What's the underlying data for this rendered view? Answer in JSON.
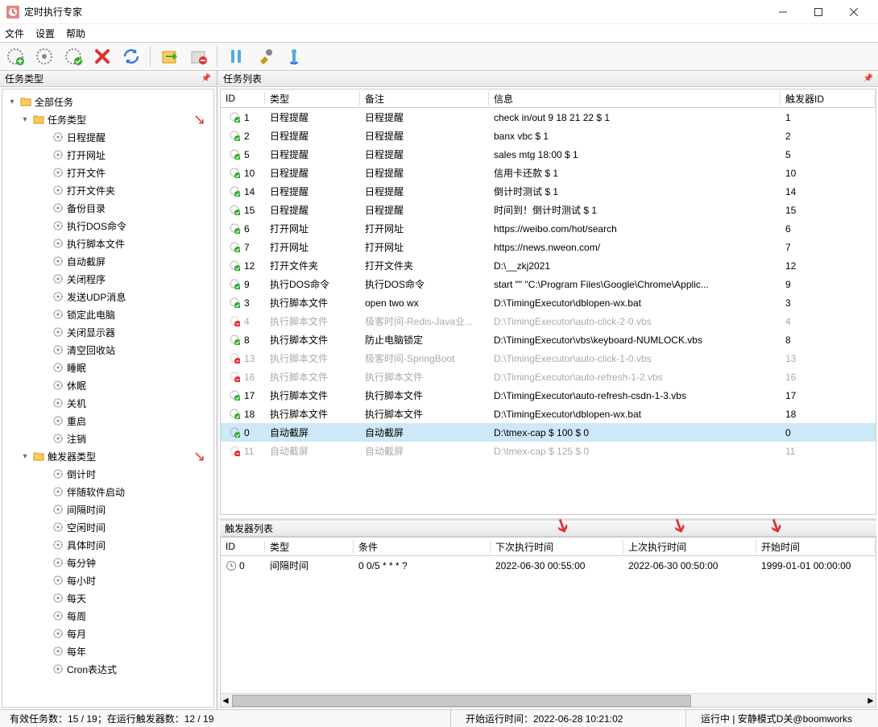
{
  "window": {
    "title": "定时执行专家"
  },
  "menu": [
    "文件",
    "设置",
    "帮助"
  ],
  "panels": {
    "taskTypes": "任务类型",
    "taskList": "任务列表",
    "triggerList": "触发器列表"
  },
  "tree": {
    "root": "全部任务",
    "g1": "任务类型",
    "g1items": [
      "日程提醒",
      "打开网址",
      "打开文件",
      "打开文件夹",
      "备份目录",
      "执行DOS命令",
      "执行脚本文件",
      "自动截屏",
      "关闭程序",
      "发送UDP消息",
      "锁定此电脑",
      "关闭显示器",
      "清空回收站",
      "睡眠",
      "休眠",
      "关机",
      "重启",
      "注销"
    ],
    "g2": "触发器类型",
    "g2items": [
      "倒计时",
      "伴随软件启动",
      "间隔时间",
      "空闲时间",
      "具体时间",
      "每分钟",
      "每小时",
      "每天",
      "每周",
      "每月",
      "每年",
      "Cron表达式"
    ]
  },
  "taskHeaders": {
    "id": "ID",
    "type": "类型",
    "note": "备注",
    "info": "信息",
    "tid": "触发器ID"
  },
  "tasks": [
    {
      "id": "1",
      "type": "日程提醒",
      "note": "日程提醒",
      "info": "check in/out 9 18 21 22 $ 1",
      "tid": "1",
      "st": "ok"
    },
    {
      "id": "2",
      "type": "日程提醒",
      "note": "日程提醒",
      "info": "banx vbc $ 1",
      "tid": "2",
      "st": "ok"
    },
    {
      "id": "5",
      "type": "日程提醒",
      "note": "日程提醒",
      "info": "sales mtg 18:00 $ 1",
      "tid": "5",
      "st": "ok"
    },
    {
      "id": "10",
      "type": "日程提醒",
      "note": "日程提醒",
      "info": "信用卡还款 $ 1",
      "tid": "10",
      "st": "ok"
    },
    {
      "id": "14",
      "type": "日程提醒",
      "note": "日程提醒",
      "info": "倒计时测试 $ 1",
      "tid": "14",
      "st": "ok"
    },
    {
      "id": "15",
      "type": "日程提醒",
      "note": "日程提醒",
      "info": "时间到！倒计时测试 $ 1",
      "tid": "15",
      "st": "ok"
    },
    {
      "id": "6",
      "type": "打开网址",
      "note": "打开网址",
      "info": "https://weibo.com/hot/search",
      "tid": "6",
      "st": "ok"
    },
    {
      "id": "7",
      "type": "打开网址",
      "note": "打开网址",
      "info": "https://news.nweon.com/",
      "tid": "7",
      "st": "ok"
    },
    {
      "id": "12",
      "type": "打开文件夹",
      "note": "打开文件夹",
      "info": "D:\\__zkj2021",
      "tid": "12",
      "st": "ok"
    },
    {
      "id": "9",
      "type": "执行DOS命令",
      "note": "执行DOS命令",
      "info": "start \"\" \"C:\\Program Files\\Google\\Chrome\\Applic...",
      "tid": "9",
      "st": "ok"
    },
    {
      "id": "3",
      "type": "执行脚本文件",
      "note": "open two wx",
      "info": "D:\\TimingExecutor\\dblopen-wx.bat",
      "tid": "3",
      "st": "ok"
    },
    {
      "id": "4",
      "type": "执行脚本文件",
      "note": "极客时间-Redis-Java业...",
      "info": "D:\\TimingExecutor\\auto-click-2-0.vbs",
      "tid": "4",
      "st": "dis"
    },
    {
      "id": "8",
      "type": "执行脚本文件",
      "note": "防止电脑锁定",
      "info": "D:\\TimingExecutor\\vbs\\keyboard-NUMLOCK.vbs",
      "tid": "8",
      "st": "ok"
    },
    {
      "id": "13",
      "type": "执行脚本文件",
      "note": "极客时间-SpringBoot",
      "info": "D:\\TimingExecutor\\auto-click-1-0.vbs",
      "tid": "13",
      "st": "dis"
    },
    {
      "id": "16",
      "type": "执行脚本文件",
      "note": "执行脚本文件",
      "info": "D:\\TimingExecutor\\auto-refresh-1-2.vbs",
      "tid": "16",
      "st": "dis"
    },
    {
      "id": "17",
      "type": "执行脚本文件",
      "note": "执行脚本文件",
      "info": "D:\\TimingExecutor\\auto-refresh-csdn-1-3.vbs",
      "tid": "17",
      "st": "ok"
    },
    {
      "id": "18",
      "type": "执行脚本文件",
      "note": "执行脚本文件",
      "info": "D:\\TimingExecutor\\dblopen-wx.bat",
      "tid": "18",
      "st": "ok"
    },
    {
      "id": "0",
      "type": "自动截屏",
      "note": "自动截屏",
      "info": "D:\\tmex-cap $ 100 $ 0",
      "tid": "0",
      "st": "ok",
      "sel": true
    },
    {
      "id": "11",
      "type": "自动截屏",
      "note": "自动截屏",
      "info": "D:\\tmex-cap $ 125 $ 0",
      "tid": "11",
      "st": "dis"
    }
  ],
  "trigHeaders": {
    "id": "ID",
    "type": "类型",
    "cond": "条件",
    "next": "下次执行时间",
    "last": "上次执行时间",
    "start": "开始时间"
  },
  "triggers": [
    {
      "id": "0",
      "type": "间隔时间",
      "cond": "0 0/5 * * * ?",
      "next": "2022-06-30 00:55:00",
      "last": "2022-06-30 00:50:00",
      "start": "1999-01-01 00:00:00"
    }
  ],
  "status": {
    "left": "有效任务数：15 / 19；在运行触发器数：12 / 19",
    "mid": "开始运行时间：2022-06-28 10:21:02",
    "right": "运行中 | 安静模式D关@boomworks"
  }
}
